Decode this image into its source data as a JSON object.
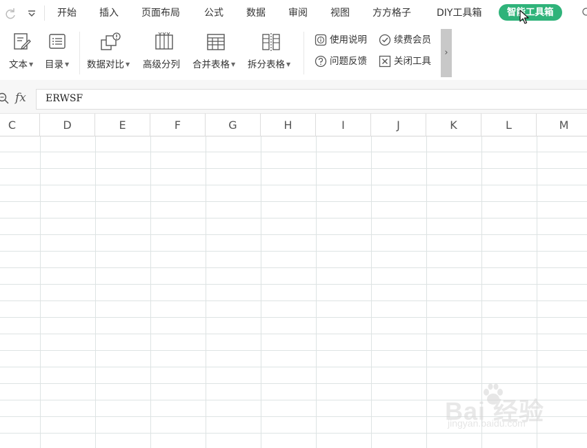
{
  "menubar": {
    "tabs": [
      {
        "label": "开始",
        "active": false
      },
      {
        "label": "插入",
        "active": false
      },
      {
        "label": "页面布局",
        "active": false
      },
      {
        "label": "公式",
        "active": false
      },
      {
        "label": "数据",
        "active": false
      },
      {
        "label": "审阅",
        "active": false
      },
      {
        "label": "视图",
        "active": false
      },
      {
        "label": "方方格子",
        "active": false
      },
      {
        "label": "DIY工具箱",
        "active": false
      },
      {
        "label": "智能工具箱",
        "active": true
      }
    ],
    "accent_color": "#2fb37a"
  },
  "ribbon": {
    "text_tool": "文本",
    "toc_tool": "目录",
    "data_compare": "数据对比",
    "advanced_split": "高级分列",
    "merge_tables": "合并表格",
    "split_tables": "拆分表格",
    "usage_guide": "使用说明",
    "renew_member": "续费会员",
    "feedback": "问题反馈",
    "close_tool": "关闭工具",
    "more_arrow": "›"
  },
  "formula_bar": {
    "fx_label": "fx",
    "content": "ERWSF"
  },
  "sheet": {
    "columns": [
      "C",
      "D",
      "E",
      "F",
      "G",
      "H",
      "I",
      "J",
      "K",
      "L",
      "M"
    ]
  },
  "watermark": {
    "brand": "Bai  经验",
    "url": "jingyan.baidu.com"
  }
}
